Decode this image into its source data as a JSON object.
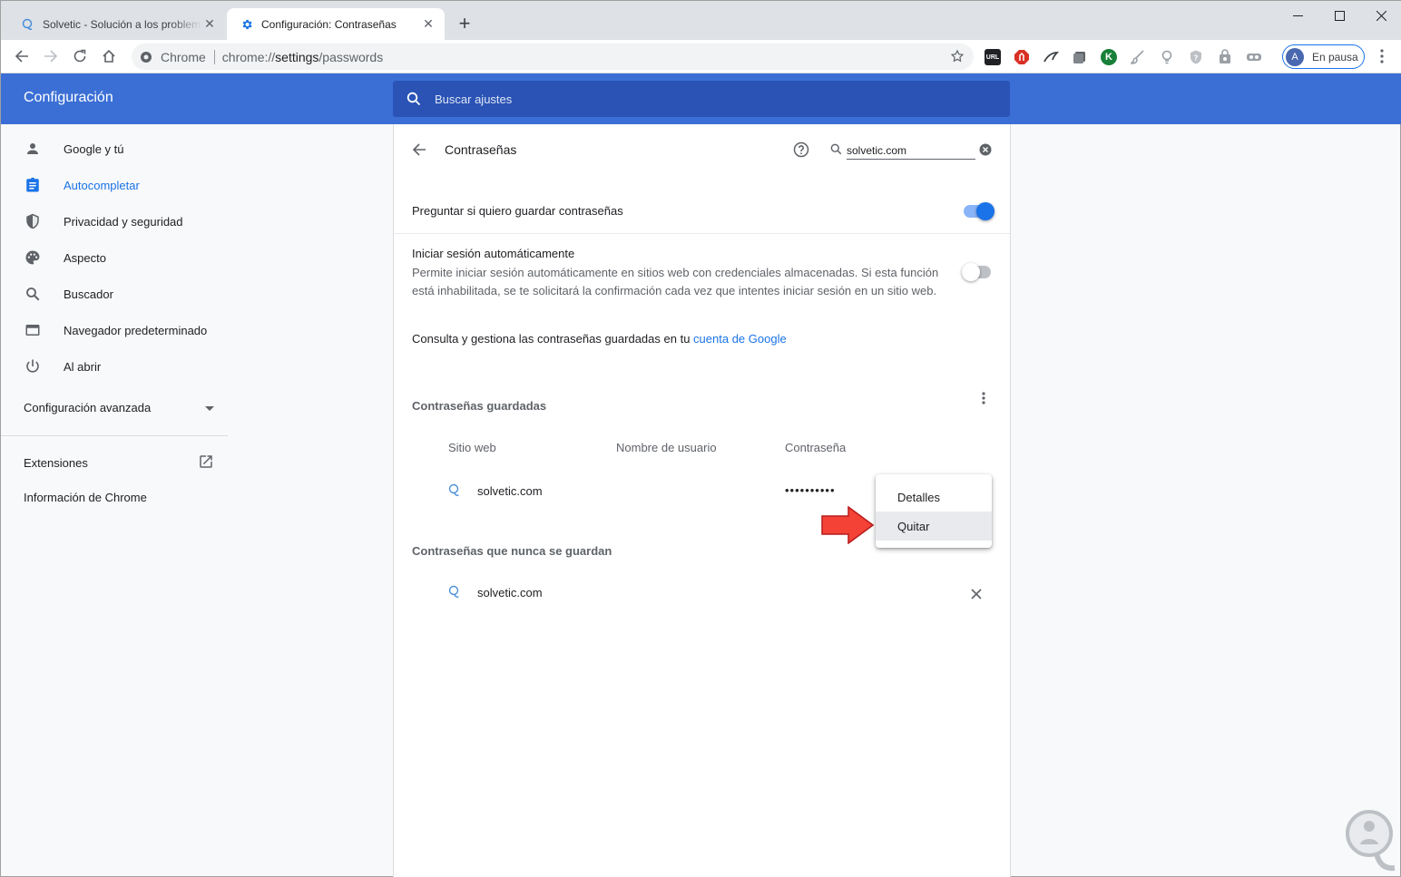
{
  "browser": {
    "tabs": [
      {
        "title": "Solvetic - Solución a los problemas",
        "favicon": "solvetic-favicon",
        "active": false
      },
      {
        "title": "Configuración: Contraseñas",
        "favicon": "gear-icon",
        "active": true
      }
    ],
    "omnibox": {
      "chip": "Chrome",
      "url_prefix": "chrome://",
      "url_host": "settings",
      "url_path": "/passwords"
    },
    "extensions": [
      {
        "name": "url-extension-icon",
        "label": "URL",
        "color": "#202124"
      },
      {
        "name": "adblock-extension-icon",
        "label": "",
        "color": "#d93025"
      },
      {
        "name": "bird-extension-icon",
        "label": "",
        "color": "#3c4043"
      },
      {
        "name": "stack-extension-icon",
        "label": "",
        "color": "#5f6368"
      },
      {
        "name": "k-extension-icon",
        "label": "K",
        "color": "#188038"
      },
      {
        "name": "brush-extension-icon",
        "label": "",
        "color": "#9aa0a6"
      },
      {
        "name": "bulb-extension-icon",
        "label": "",
        "color": "#9aa0a6"
      },
      {
        "name": "shield-extension-icon",
        "label": "",
        "color": "#9aa0a6"
      },
      {
        "name": "bag-extension-icon",
        "label": "",
        "color": "#9aa0a6"
      },
      {
        "name": "link-extension-icon",
        "label": "",
        "color": "#9aa0a6"
      }
    ],
    "profile": {
      "initial": "A",
      "label": "En pausa"
    }
  },
  "header": {
    "title": "Configuración",
    "search_placeholder": "Buscar ajustes"
  },
  "sidebar": {
    "items": [
      {
        "label": "Google y tú",
        "icon": "person-icon"
      },
      {
        "label": "Autocompletar",
        "icon": "clipboard-icon",
        "active": true
      },
      {
        "label": "Privacidad y seguridad",
        "icon": "shield-icon"
      },
      {
        "label": "Aspecto",
        "icon": "palette-icon"
      },
      {
        "label": "Buscador",
        "icon": "search-icon"
      },
      {
        "label": "Navegador predeterminado",
        "icon": "browser-window-icon"
      },
      {
        "label": "Al abrir",
        "icon": "power-icon"
      }
    ],
    "advanced": "Configuración avanzada",
    "extensions": "Extensiones",
    "about": "Información de Chrome"
  },
  "passwords": {
    "title": "Contraseñas",
    "search_value": "solvetic.com",
    "offer_save": {
      "label": "Preguntar si quiero guardar contraseñas",
      "enabled": true
    },
    "auto_signin": {
      "title": "Iniciar sesión automáticamente",
      "description": "Permite iniciar sesión automáticamente en sitios web con credenciales almacenadas. Si esta función está inhabilitada, se te solicitará la confirmación cada vez que intentes iniciar sesión en un sitio web.",
      "enabled": false
    },
    "account_text": "Consulta y gestiona las contraseñas guardadas en tu",
    "account_link": "cuenta de Google",
    "saved": {
      "title": "Contraseñas guardadas",
      "columns": [
        "Sitio web",
        "Nombre de usuario",
        "Contraseña"
      ],
      "rows": [
        {
          "site": "solvetic.com",
          "username": "",
          "password": "••••••••••"
        }
      ]
    },
    "never_saved": {
      "title": "Contraseñas que nunca se guardan",
      "rows": [
        {
          "site": "solvetic.com"
        }
      ]
    },
    "context_menu": {
      "items": [
        "Detalles",
        "Quitar"
      ],
      "hovered": "Quitar"
    }
  },
  "colors": {
    "header_blue": "#3b6fd6",
    "accent": "#1a73e8",
    "arrow_red": "#f44336"
  }
}
